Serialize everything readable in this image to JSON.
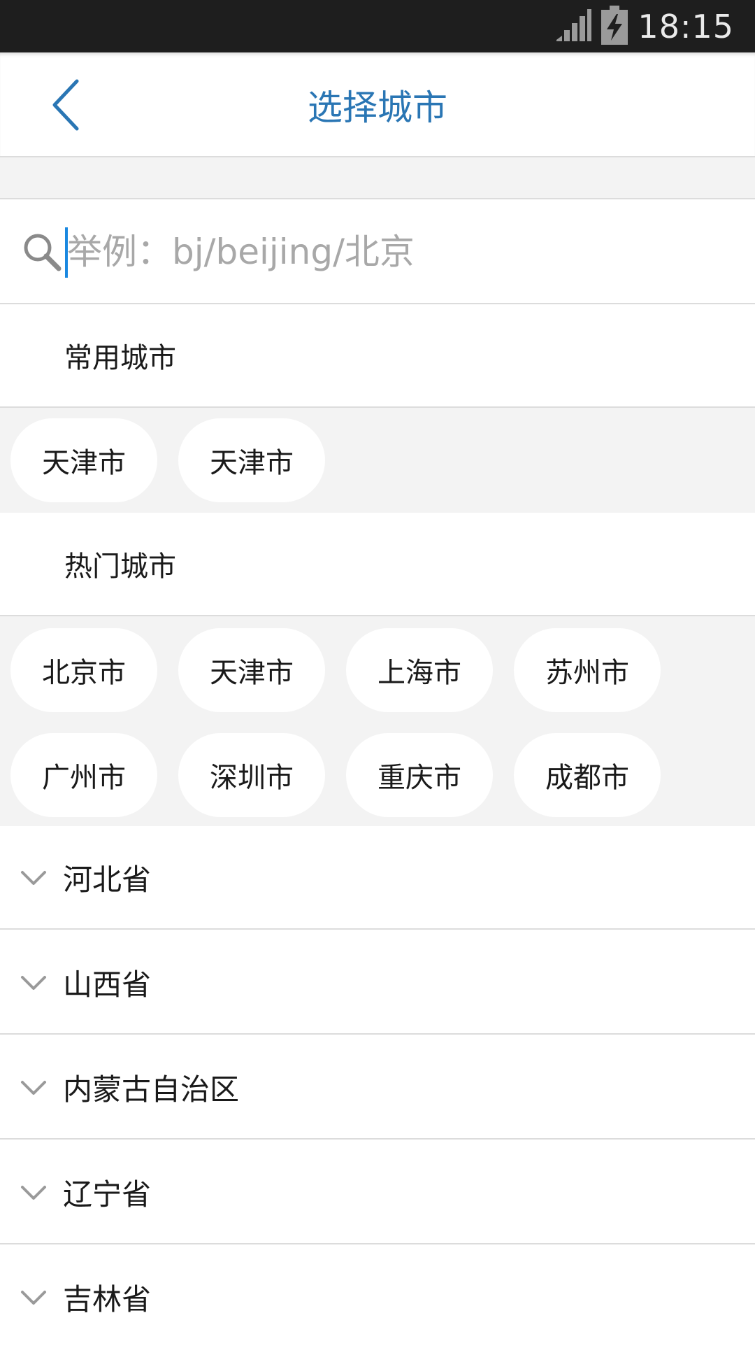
{
  "status_bar": {
    "time": "18:15",
    "icons": [
      "signal-icon",
      "battery-charging-icon"
    ]
  },
  "header": {
    "title": "选择城市",
    "back_icon": "chevron-left-icon",
    "accent_color": "#2a76b4"
  },
  "search": {
    "placeholder": "举例：bj/beijing/北京",
    "value": "",
    "icon": "search-icon"
  },
  "frequent": {
    "title": "常用城市",
    "cities": [
      "天津市",
      "天津市"
    ]
  },
  "hot": {
    "title": "热门城市",
    "cities": [
      "北京市",
      "天津市",
      "上海市",
      "苏州市",
      "广州市",
      "深圳市",
      "重庆市",
      "成都市"
    ]
  },
  "provinces": [
    "河北省",
    "山西省",
    "内蒙古自治区",
    "辽宁省",
    "吉林省"
  ]
}
